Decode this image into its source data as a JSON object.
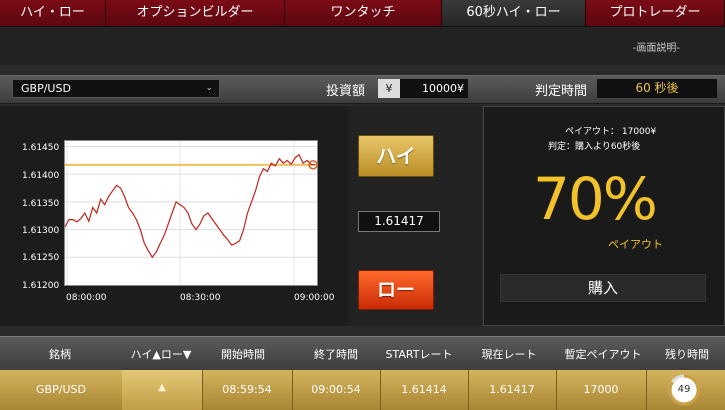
{
  "tabs": [
    {
      "label": "ハイ・ロー"
    },
    {
      "label": "オプションビルダー"
    },
    {
      "label": "ワンタッチ"
    },
    {
      "label": "60秒ハイ・ロー"
    },
    {
      "label": "プロトレーダー"
    }
  ],
  "description_link": "-画面説明-",
  "controls": {
    "pair": "GBP/USD",
    "investment_label": "投資額",
    "yen_symbol": "¥",
    "investment_value": "10000¥",
    "judge_label": "判定時間",
    "judge_value": "60 秒後"
  },
  "chart": {
    "y_ticks": [
      "1.61450",
      "1.61400",
      "1.61350",
      "1.61300",
      "1.61250",
      "1.61200"
    ],
    "x_ticks": [
      "08:00:00",
      "08:30:00",
      "09:00:00"
    ],
    "reference_rate": 1.61417
  },
  "trade": {
    "high_label": "ハイ",
    "current_rate": "1.61417",
    "low_label": "ロー"
  },
  "payout": {
    "payout_line": "ペイアウト： 17000¥",
    "judge_line": "判定：購入より60秒後",
    "percent": "70%",
    "percent_label": "ペイアウト",
    "buy_label": "購入"
  },
  "table": {
    "headers": [
      "銘柄",
      "ハイ▲ロー▼",
      "開始時間",
      "終了時間",
      "STARTレート",
      "現在レート",
      "暫定ペイアウト",
      "残り時間"
    ],
    "row": {
      "pair": "GBP/USD",
      "direction_icon": "triangle-up",
      "start_time": "08:59:54",
      "end_time": "09:00:54",
      "start_rate": "1.61414",
      "current_rate": "1.61417",
      "payout": "17000",
      "remaining": "49"
    }
  },
  "colors": {
    "tab_red": "#6d0912",
    "gold": "#f2c22b",
    "high_button": "#d4ad45",
    "low_button": "#e2430f"
  }
}
